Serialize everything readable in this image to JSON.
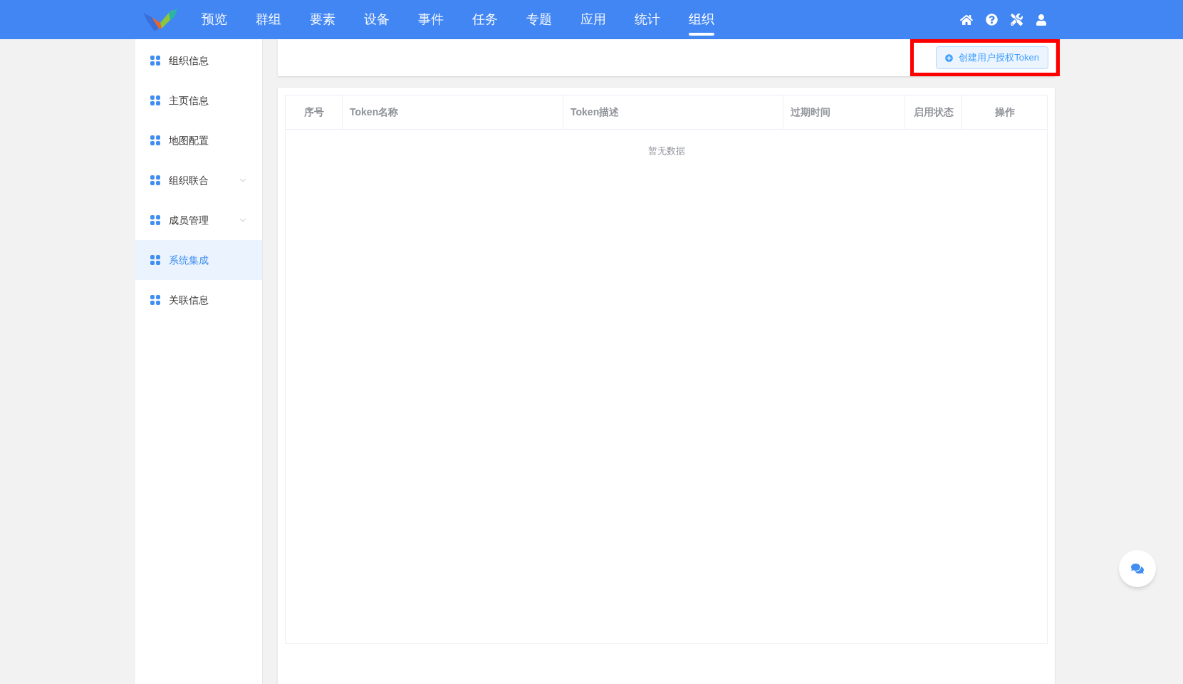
{
  "nav": {
    "items": [
      {
        "label": "预览",
        "selected": false
      },
      {
        "label": "群组",
        "selected": false
      },
      {
        "label": "要素",
        "selected": false
      },
      {
        "label": "设备",
        "selected": false
      },
      {
        "label": "事件",
        "selected": false
      },
      {
        "label": "任务",
        "selected": false
      },
      {
        "label": "专题",
        "selected": false
      },
      {
        "label": "应用",
        "selected": false
      },
      {
        "label": "统计",
        "selected": false
      },
      {
        "label": "组织",
        "selected": true
      }
    ]
  },
  "sidebar": {
    "items": [
      {
        "label": "组织信息",
        "selected": false,
        "expandable": false
      },
      {
        "label": "主页信息",
        "selected": false,
        "expandable": false
      },
      {
        "label": "地图配置",
        "selected": false,
        "expandable": false
      },
      {
        "label": "组织联合",
        "selected": false,
        "expandable": true
      },
      {
        "label": "成员管理",
        "selected": false,
        "expandable": true
      },
      {
        "label": "系统集成",
        "selected": true,
        "expandable": false
      },
      {
        "label": "关联信息",
        "selected": false,
        "expandable": false
      }
    ]
  },
  "toolbar": {
    "create_button": "创建用户授权Token",
    "highlighted": true
  },
  "table": {
    "columns": [
      {
        "label": "序号"
      },
      {
        "label": "Token名称"
      },
      {
        "label": "Token描述"
      },
      {
        "label": "过期时间"
      },
      {
        "label": "启用状态"
      },
      {
        "label": "操作"
      }
    ],
    "empty_text": "暂无数据"
  }
}
